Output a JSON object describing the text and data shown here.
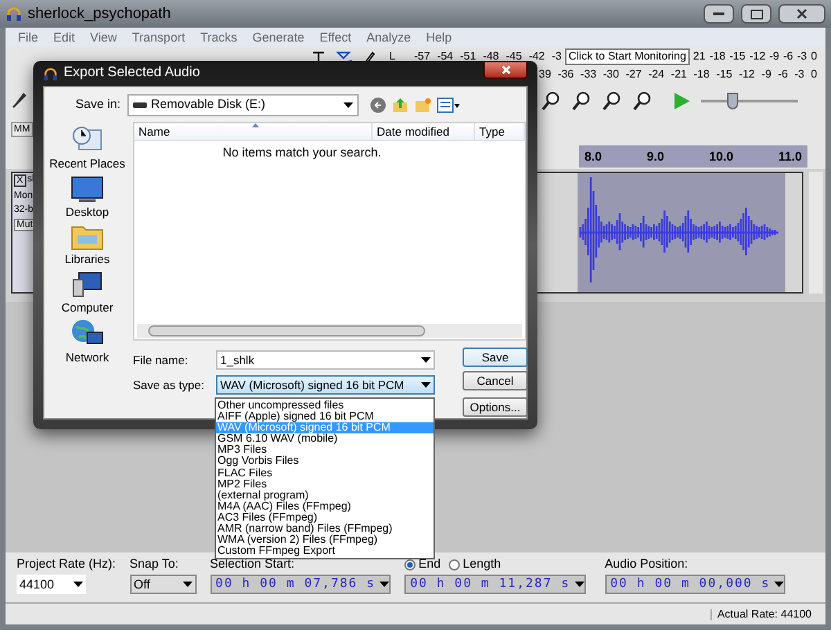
{
  "window": {
    "title": "sherlock_psychopath"
  },
  "menu": [
    "File",
    "Edit",
    "View",
    "Transport",
    "Tracks",
    "Generate",
    "Effect",
    "Analyze",
    "Help"
  ],
  "meters": {
    "recording_label": "L",
    "recording_left_ticks": [
      "-57",
      "-54",
      "-51",
      "-48",
      "-45",
      "-42",
      "-3"
    ],
    "tooltip": "Click to Start Monitoring",
    "recording_right_ticks": [
      "21",
      "-18",
      "-15",
      "-12",
      "-9",
      "-6",
      "-3",
      "0"
    ],
    "playback_ticks": [
      "39",
      "-36",
      "-33",
      "-30",
      "-27",
      "-24",
      "-21",
      "-18",
      "-15",
      "-12",
      "-9",
      "-6",
      "-3",
      "0"
    ]
  },
  "speed_slider": {
    "level": 0.3
  },
  "toolbar_row_3": {
    "label": "MM"
  },
  "ruler": {
    "ticks": [
      "8.0",
      "9.0",
      "10.0",
      "11.0"
    ]
  },
  "track": {
    "close": "X",
    "name": "sl",
    "channels": "Mon",
    "format": "32-b",
    "mute": "Mut"
  },
  "dialog": {
    "title": "Export Selected Audio",
    "save_in_label": "Save in:",
    "save_in": "Removable Disk (E:)",
    "places": [
      {
        "label": "Recent Places",
        "kind": "recent"
      },
      {
        "label": "Desktop",
        "kind": "desktop"
      },
      {
        "label": "Libraries",
        "kind": "libraries"
      },
      {
        "label": "Computer",
        "kind": "computer"
      },
      {
        "label": "Network",
        "kind": "network"
      }
    ],
    "columns": [
      "Name",
      "Date modified",
      "Type"
    ],
    "empty_message": "No items match your search.",
    "file_name_label": "File name:",
    "file_name": "1_shlk",
    "type_label": "Save as type:",
    "type_value": "WAV (Microsoft) signed 16 bit PCM",
    "buttons": [
      "Save",
      "Cancel",
      "Options..."
    ],
    "type_options": [
      {
        "label": "Other uncompressed files",
        "selected": false
      },
      {
        "label": "AIFF (Apple) signed 16 bit PCM",
        "selected": false
      },
      {
        "label": "WAV (Microsoft) signed 16 bit PCM",
        "selected": true
      },
      {
        "label": "GSM 6.10 WAV (mobile)",
        "selected": false
      },
      {
        "label": "MP3 Files",
        "selected": false
      },
      {
        "label": "Ogg Vorbis Files",
        "selected": false
      },
      {
        "label": "FLAC Files",
        "selected": false
      },
      {
        "label": "MP2 Files",
        "selected": false
      },
      {
        "label": "(external program)",
        "selected": false
      },
      {
        "label": "M4A (AAC) Files (FFmpeg)",
        "selected": false
      },
      {
        "label": "AC3 Files (FFmpeg)",
        "selected": false
      },
      {
        "label": "AMR (narrow band) Files (FFmpeg)",
        "selected": false
      },
      {
        "label": "WMA (version 2) Files (FFmpeg)",
        "selected": false
      },
      {
        "label": "Custom FFmpeg Export",
        "selected": false
      }
    ]
  },
  "selection_bar": {
    "rate_label": "Project Rate (Hz):",
    "rate": "44100",
    "snap_label": "Snap To:",
    "snap": "Off",
    "start_label": "Selection Start:",
    "start": "00 h 00 m 07,786 s",
    "modes": [
      {
        "label": "End",
        "selected": true
      },
      {
        "label": "Length",
        "selected": false
      }
    ],
    "end": "00 h 00 m 11,287 s",
    "position_label": "Audio Position:",
    "position": "00 h 00 m 00,000 s"
  },
  "status_bar": {
    "rate": "Actual Rate: 44100"
  }
}
